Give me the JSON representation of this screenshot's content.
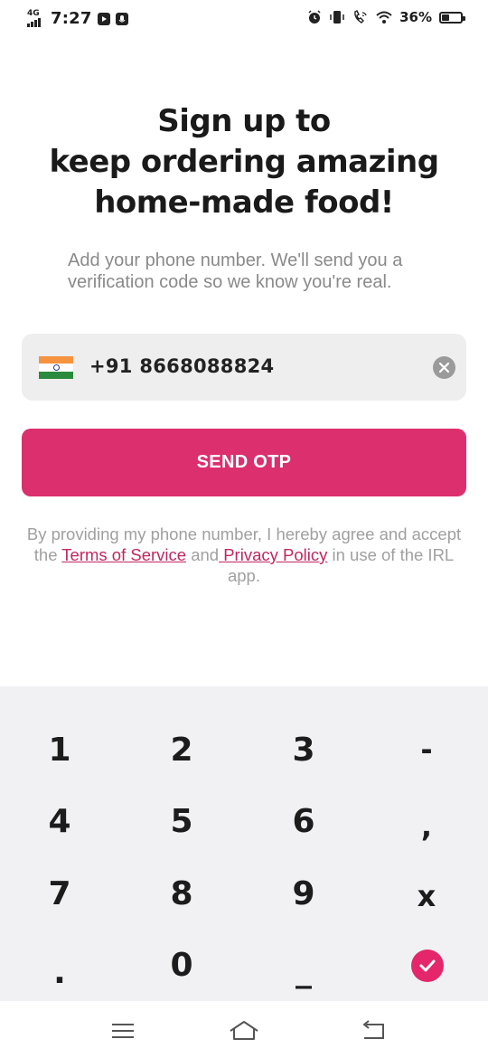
{
  "status_bar": {
    "network": "4G",
    "time": "7:27",
    "battery_percent": "36%",
    "battery_level": 0.36,
    "icons": [
      "youtube-icon",
      "microphone-icon",
      "alarm-icon",
      "vibrate-icon",
      "wifi-call-icon",
      "wifi-icon",
      "battery-icon"
    ]
  },
  "headline": {
    "line1": "Sign up to",
    "line2": "keep ordering amazing",
    "line3": "home-made food!"
  },
  "subtitle": {
    "line1": "Add your phone number. We'll send you a",
    "line2": "verification code so we know you're real."
  },
  "phone": {
    "country_flag": "india-flag",
    "value": "+91 8668088824"
  },
  "send_button": "SEND OTP",
  "terms": {
    "prefix": "By providing my phone number, I hereby agree and accept the ",
    "terms_link": "Terms of Service",
    "middle": " and",
    "privacy_link": " Privacy Policy",
    "suffix": " in use of the IRL app."
  },
  "keypad": {
    "row1": [
      "1",
      "2",
      "3",
      "-"
    ],
    "row2": [
      "4",
      "5",
      "6",
      ","
    ],
    "row3": [
      "7",
      "8",
      "9",
      "x"
    ],
    "row4": [
      ".",
      "0",
      "_"
    ],
    "done": "check-icon",
    "accent_color": "#e5266a"
  },
  "brand_color": "#dc2f6d",
  "nav_bar": {
    "icons": [
      "menu-icon",
      "home-icon",
      "back-icon"
    ]
  }
}
